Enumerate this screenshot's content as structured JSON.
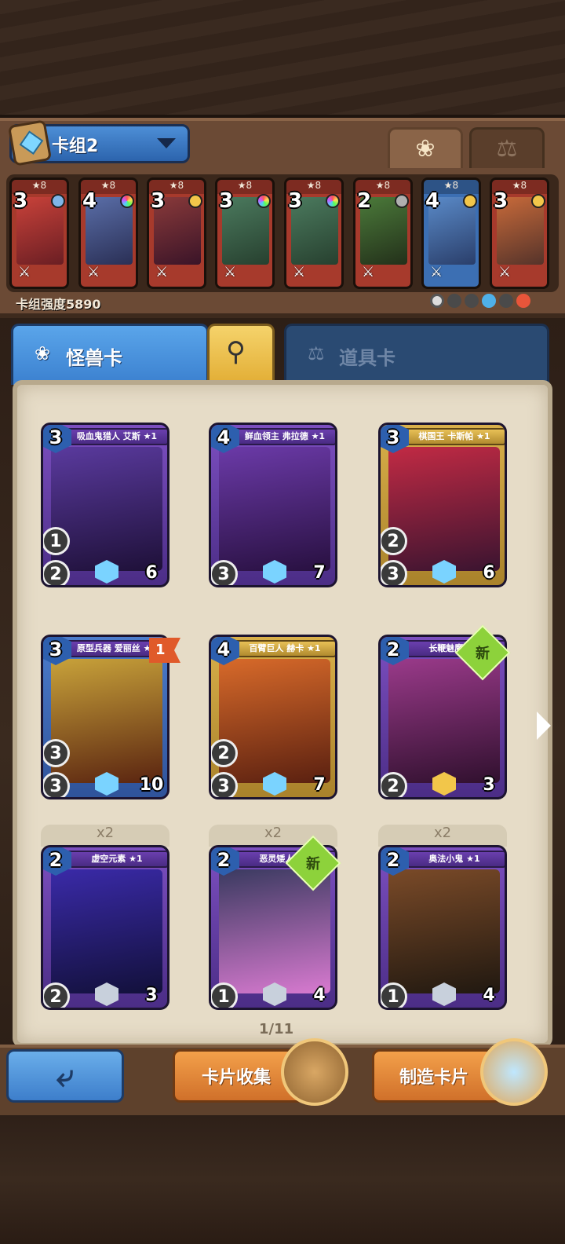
{
  "deck": {
    "name": "卡组2",
    "strength_label": "卡组强度5890",
    "cards": [
      {
        "cost": "3",
        "stars": "★8",
        "color": "red",
        "gem": "#7fb6e8"
      },
      {
        "cost": "4",
        "stars": "★8",
        "color": "red",
        "gem": "rainbow"
      },
      {
        "cost": "3",
        "stars": "★8",
        "color": "red",
        "gem": "#f2c64a"
      },
      {
        "cost": "3",
        "stars": "★8",
        "color": "red",
        "gem": "rainbow"
      },
      {
        "cost": "3",
        "stars": "★8",
        "color": "red",
        "gem": "rainbow"
      },
      {
        "cost": "2",
        "stars": "★8",
        "color": "red",
        "gem": "#b0b0b0"
      },
      {
        "cost": "4",
        "stars": "★8",
        "color": "blue",
        "gem": "#f2c64a"
      },
      {
        "cost": "3",
        "stars": "★8",
        "color": "red",
        "gem": "#f2c64a"
      }
    ]
  },
  "tabs": {
    "monster": "怪兽卡",
    "item": "道具卡"
  },
  "collection": {
    "cards": [
      {
        "cost": "3",
        "name": "吸血鬼猎人 艾斯 ★1",
        "atk": "1",
        "def": "2",
        "hp": "6",
        "count": ""
      },
      {
        "cost": "4",
        "name": "鲜血领主 弗拉德 ★1",
        "atk": "",
        "def": "3",
        "hp": "7",
        "count": ""
      },
      {
        "cost": "3",
        "name": "棋国王 卡斯帕 ★1",
        "atk": "2",
        "def": "3",
        "hp": "6",
        "count": ""
      },
      {
        "cost": "3",
        "name": "原型兵器 爱丽丝 ★8",
        "atk": "3",
        "def": "3",
        "hp": "10",
        "count": "",
        "badge": "1"
      },
      {
        "cost": "4",
        "name": "百臂巨人 赫卡 ★1",
        "atk": "2",
        "def": "3",
        "hp": "7",
        "count": ""
      },
      {
        "cost": "2",
        "name": "长鞭魅魔 ★1",
        "atk": "",
        "def": "2",
        "hp": "3",
        "count": "",
        "new": "新"
      },
      {
        "cost": "2",
        "name": "虚空元素 ★1",
        "atk": "",
        "def": "2",
        "hp": "3",
        "count": "x2"
      },
      {
        "cost": "2",
        "name": "恶灵矮人 ★1",
        "atk": "",
        "def": "1",
        "hp": "4",
        "count": "x2",
        "new": "新"
      },
      {
        "cost": "2",
        "name": "奥法小鬼 ★1",
        "atk": "",
        "def": "1",
        "hp": "4",
        "count": "x2"
      }
    ],
    "page": "1/11"
  },
  "buttons": {
    "collection": "卡片收集",
    "craft": "制造卡片"
  }
}
